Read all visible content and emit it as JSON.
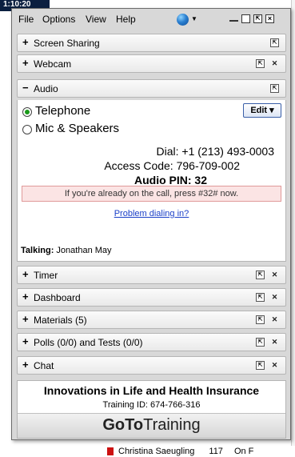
{
  "background": {
    "top_left_text": "1:10:20",
    "bottom_row": {
      "name": "Christina Saeugling",
      "count": "117",
      "status": "On F"
    }
  },
  "menubar": {
    "items": [
      "File",
      "Options",
      "View",
      "Help"
    ],
    "globe_icon": "globe-icon",
    "window_buttons": [
      "minimize",
      "restore",
      "popout",
      "close"
    ]
  },
  "sections_top": [
    {
      "label": "Screen Sharing",
      "expanded": false
    },
    {
      "label": "Webcam",
      "expanded": false
    }
  ],
  "audio": {
    "label": "Audio",
    "expanded": true,
    "options": [
      "Telephone",
      "Mic & Speakers"
    ],
    "selected": "Telephone",
    "edit_label": "Edit ▾",
    "dial": "Dial: +1 (213) 493-0003",
    "access_code": "Access Code: 796-709-002",
    "audio_pin": "Audio PIN: 32",
    "notice": "If you're already on the call, press #32# now.",
    "problem_link": "Problem dialing in?",
    "talking_label": "Talking:",
    "talking_name": "Jonathan May"
  },
  "sections_bottom": [
    {
      "label": "Timer"
    },
    {
      "label": "Dashboard"
    },
    {
      "label": "Materials (5)"
    },
    {
      "label": "Polls (0/0) and Tests (0/0)"
    },
    {
      "label": "Chat"
    }
  ],
  "footer": {
    "course": "Innovations in Life and Health Insurance",
    "training_id": "Training ID: 674-766-316",
    "brand_bold": "GoTo",
    "brand_rest": "Training"
  },
  "colors": {
    "notice_bg": "#fbe4e4",
    "link": "#1a3fc8",
    "radio_selected": "#1a9a1a",
    "panel_bg": "#d8d8d8"
  }
}
